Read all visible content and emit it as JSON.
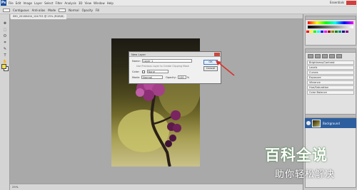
{
  "app": {
    "logo_text": "Ps",
    "menu": [
      "File",
      "Edit",
      "Image",
      "Layer",
      "Select",
      "Filter",
      "Analysis",
      "3D",
      "View",
      "Window",
      "Help"
    ],
    "workspace_label": "Essentials"
  },
  "options_bar": {
    "items": [
      "Contiguous",
      "Anti-alias",
      "Mode",
      "Normal",
      "Opacity",
      "Fill"
    ]
  },
  "document": {
    "tab_label": "IMG_20180404_104753 @ 25% (RGB/8)",
    "status_text": "25%"
  },
  "dialog": {
    "title": "New Layer",
    "name_label": "Name:",
    "name_value": "Layer 1",
    "hint": "Use Previous Layer to Create Clipping Mask",
    "color_label": "Color:",
    "color_value": "None",
    "mode_label": "Mode:",
    "mode_value": "Normal",
    "opacity_label": "Opacity:",
    "opacity_value": "100",
    "opacity_unit": "%",
    "ok_label": "OK",
    "cancel_label": "Cancel"
  },
  "panels": {
    "adjustments": [
      "Brightness/Contrast",
      "Levels",
      "Curves",
      "Exposure",
      "Vibrance",
      "Hue/Saturation",
      "Color Balance"
    ],
    "layer_name": "Background"
  },
  "watermark": {
    "title": "百科全说",
    "subtitle": "助你轻松解决"
  },
  "colors": {
    "accent": "#2d5e9e",
    "annotation": "#d9302b",
    "foreground": "#f0e14a"
  }
}
